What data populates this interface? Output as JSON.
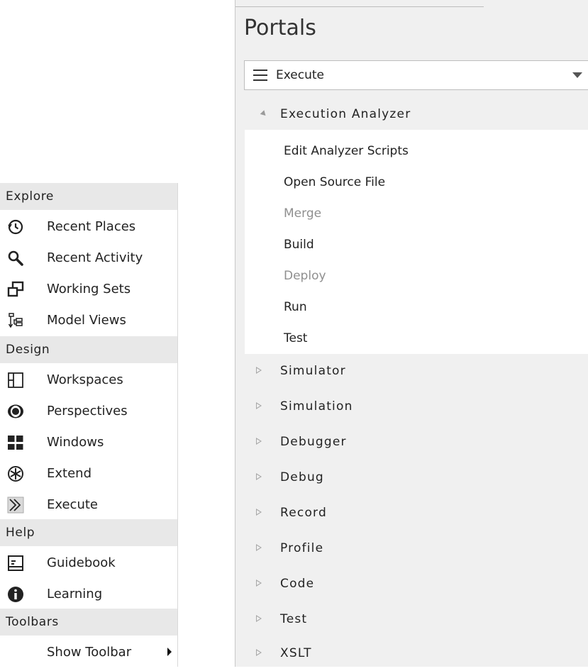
{
  "left_menu": {
    "sections": [
      {
        "title": "Explore",
        "items": [
          {
            "label": "Recent Places",
            "icon": "history-icon"
          },
          {
            "label": "Recent Activity",
            "icon": "magnifier-icon"
          },
          {
            "label": "Working Sets",
            "icon": "working-sets-icon"
          },
          {
            "label": "Model Views",
            "icon": "model-views-icon"
          }
        ]
      },
      {
        "title": "Design",
        "items": [
          {
            "label": "Workspaces",
            "icon": "workspaces-icon"
          },
          {
            "label": "Perspectives",
            "icon": "eye-icon"
          },
          {
            "label": "Windows",
            "icon": "windows-grid-icon"
          },
          {
            "label": "Extend",
            "icon": "extend-icon"
          },
          {
            "label": "Execute",
            "icon": "execute-icon"
          }
        ]
      },
      {
        "title": "Help",
        "items": [
          {
            "label": "Guidebook",
            "icon": "guidebook-icon"
          },
          {
            "label": "Learning",
            "icon": "info-icon"
          }
        ]
      },
      {
        "title": "Toolbars",
        "items": [
          {
            "label": "Show Toolbar",
            "icon": "submenu-arrow-icon"
          }
        ]
      }
    ]
  },
  "portals": {
    "title": "Portals",
    "selector": {
      "value": "Execute"
    },
    "expanded_group": {
      "label": "Execution Analyzer",
      "items": [
        {
          "label": "Edit Analyzer Scripts",
          "enabled": true
        },
        {
          "label": "Open Source File",
          "enabled": true
        },
        {
          "label": "Merge",
          "enabled": false
        },
        {
          "label": "Build",
          "enabled": true
        },
        {
          "label": "Deploy",
          "enabled": false
        },
        {
          "label": "Run",
          "enabled": true
        },
        {
          "label": "Test",
          "enabled": true
        }
      ]
    },
    "collapsed_groups": [
      "Simulator",
      "Simulation",
      "Debugger",
      "Debug",
      "Record",
      "Profile",
      "Code",
      "Test",
      "XSLT"
    ]
  },
  "colors": {
    "section_header_bg": "#e8e8e8",
    "panel_bg": "#f0f0f0",
    "disabled_text": "#8f8f8f"
  }
}
